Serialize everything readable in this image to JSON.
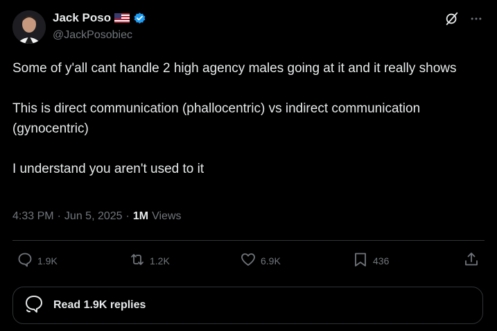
{
  "author": {
    "display_name": "Jack Poso",
    "handle": "@JackPosobiec",
    "flag_icon": "us-flag-icon",
    "verified_icon": "verified-badge-icon",
    "verified_color": "#1d9bf0"
  },
  "tweet": {
    "text": "Some of y'all cant handle 2 high agency males going at it and it really shows\n\nThis is direct communication (phallocentric) vs indirect communication (gynocentric)\n\nI understand you aren't used to it",
    "time": "4:33 PM",
    "date": "Jun 5, 2025",
    "views_count": "1M",
    "views_label": "Views"
  },
  "actions": {
    "reply_count": "1.9K",
    "retweet_count": "1.2K",
    "like_count": "6.9K",
    "bookmark_count": "436"
  },
  "replies_button": {
    "label": "Read 1.9K replies"
  },
  "colors": {
    "background": "#000000",
    "text": "#e7e9ea",
    "muted": "#71767b",
    "divider": "#2f3336"
  }
}
